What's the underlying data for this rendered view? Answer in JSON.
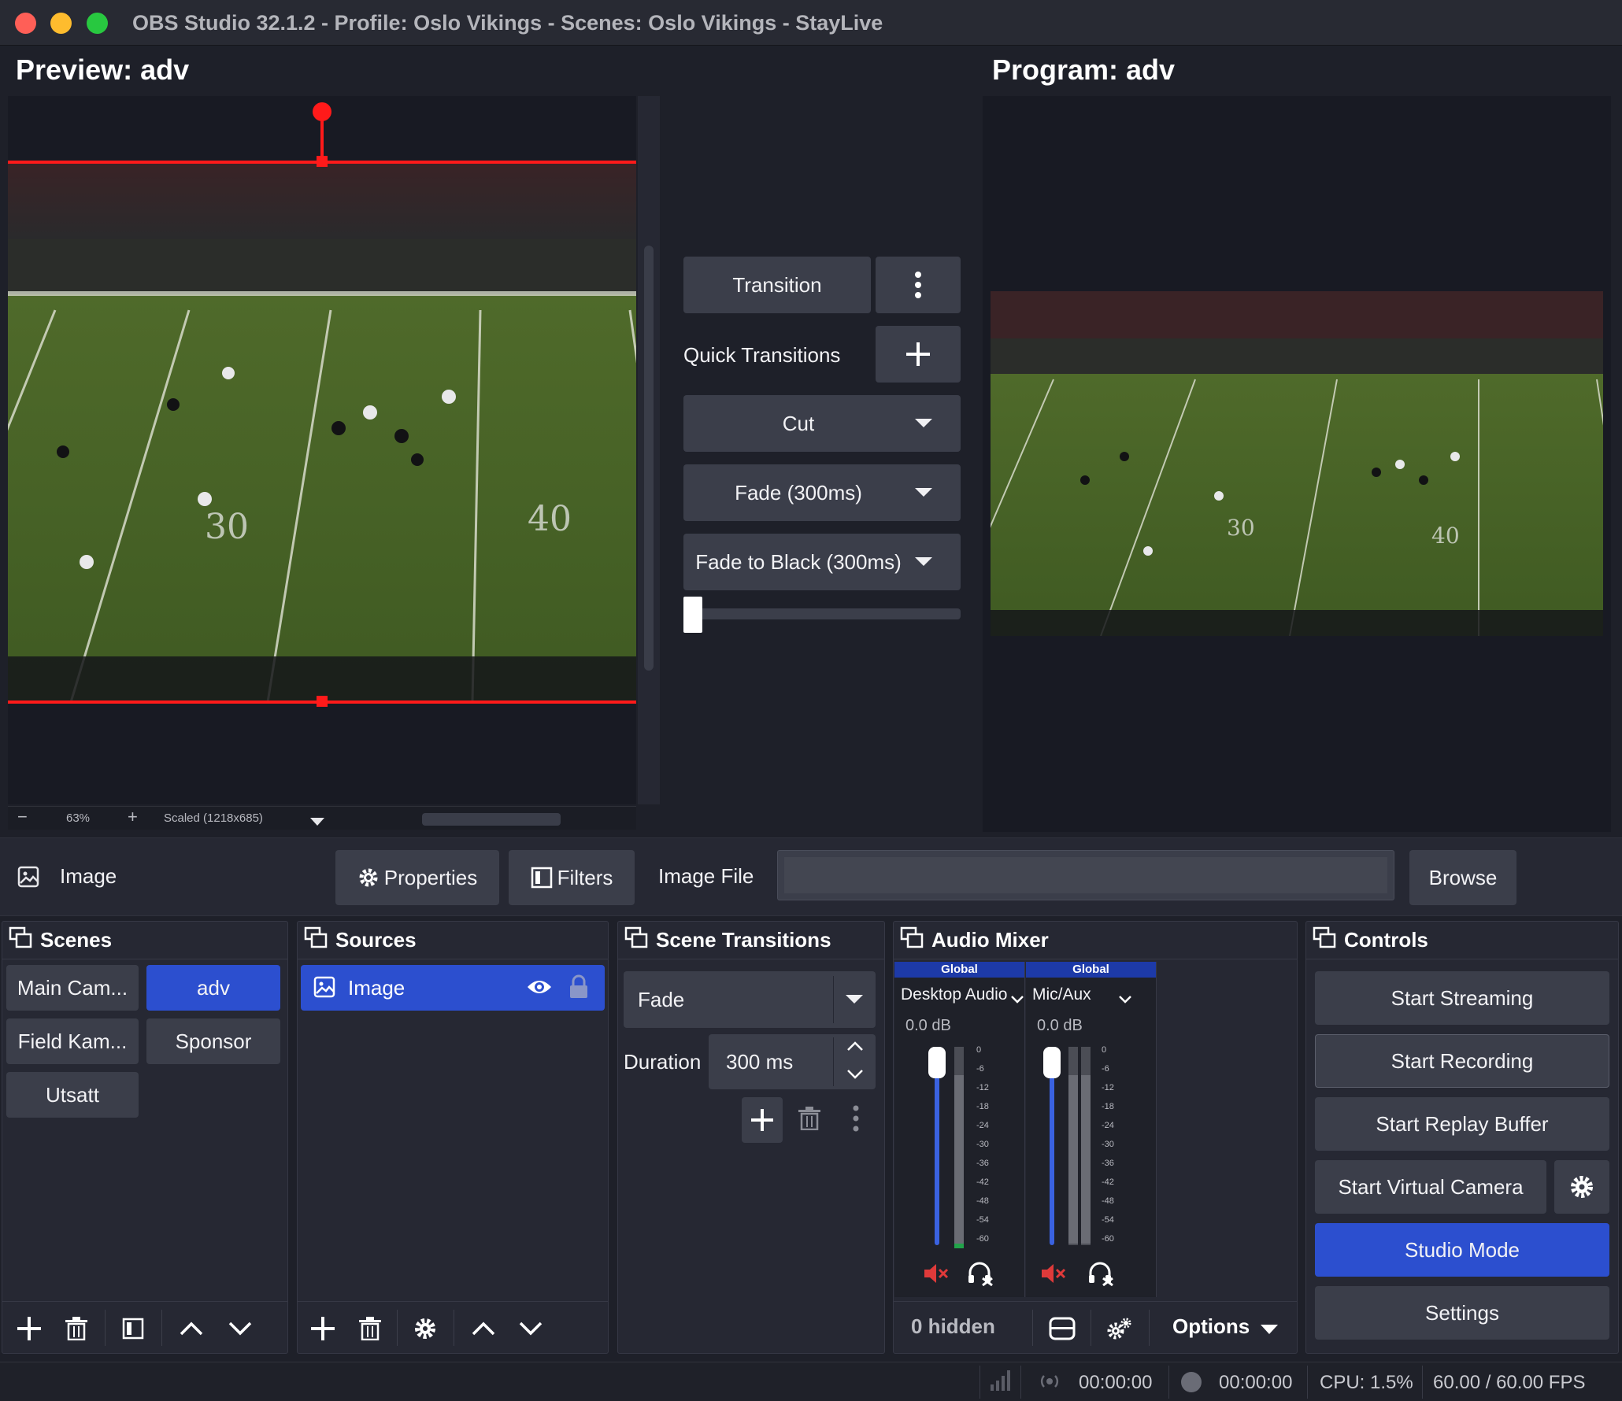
{
  "window": {
    "title": "OBS Studio 32.1.2 - Profile: Oslo Vikings - Scenes: Oslo Vikings - StayLive"
  },
  "preview": {
    "heading": "Preview: adv",
    "zoom": "63%",
    "scale_mode": "Scaled (1218x685)"
  },
  "program": {
    "heading": "Program: adv"
  },
  "transitions_panel": {
    "transition_label": "Transition",
    "quick_transitions_label": "Quick Transitions",
    "quick_items": [
      "Cut",
      "Fade (300ms)",
      "Fade to Black (300ms)"
    ],
    "tbar_position": 0
  },
  "source_toolbar": {
    "source_name": "Image",
    "properties_label": "Properties",
    "filters_label": "Filters",
    "image_file_label": "Image File",
    "image_file_value": "",
    "browse_label": "Browse"
  },
  "scenes": {
    "title": "Scenes",
    "items": [
      {
        "label": "Main Cam...",
        "active": false
      },
      {
        "label": "adv",
        "active": true
      },
      {
        "label": "Field Kam...",
        "active": false
      },
      {
        "label": "Sponsor",
        "active": false
      },
      {
        "label": "Utsatt",
        "active": false
      }
    ]
  },
  "sources": {
    "title": "Sources",
    "items": [
      {
        "label": "Image",
        "visible": true,
        "locked": true
      }
    ]
  },
  "scene_transitions": {
    "title": "Scene Transitions",
    "selected": "Fade",
    "duration_label": "Duration",
    "duration_value": "300 ms"
  },
  "audio_mixer": {
    "title": "Audio Mixer",
    "channels": [
      {
        "global": "Global",
        "name": "Desktop Audio",
        "db": "0.0 dB",
        "muted": true
      },
      {
        "global": "Global",
        "name": "Mic/Aux",
        "db": "0.0 dB",
        "muted": true
      }
    ],
    "scale": [
      "0",
      "-6",
      "-12",
      "-18",
      "-24",
      "-30",
      "-36",
      "-42",
      "-48",
      "-54",
      "-60"
    ],
    "hidden_label": "0 hidden",
    "options_label": "Options"
  },
  "controls": {
    "title": "Controls",
    "start_streaming": "Start Streaming",
    "start_recording": "Start Recording",
    "start_replay_buffer": "Start Replay Buffer",
    "start_virtual_camera": "Start Virtual Camera",
    "studio_mode": "Studio Mode",
    "settings": "Settings"
  },
  "status_bar": {
    "stream_time": "00:00:00",
    "record_time": "00:00:00",
    "cpu": "CPU: 1.5%",
    "fps": "60.00 / 60.00 FPS"
  },
  "colors": {
    "accent": "#2c4fcf",
    "selection": "#ff1a1a",
    "background": "#1e2029",
    "panel": "#262833",
    "button": "#3b3e4a"
  }
}
